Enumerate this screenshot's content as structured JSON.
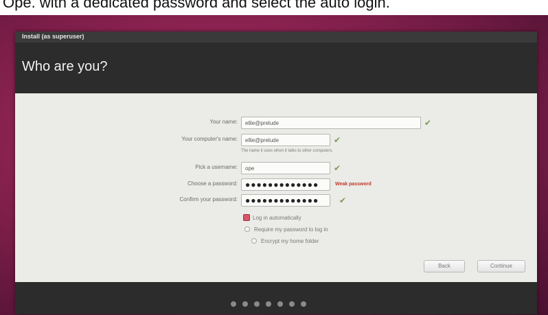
{
  "caption": {
    "text": "Ope. with a dedicated password and select the auto login."
  },
  "window": {
    "title": "Install (as superuser)",
    "heading": "Who are you?"
  },
  "form": {
    "name": {
      "label": "Your name:",
      "value": "ellie@prelude"
    },
    "computer_name": {
      "label": "Your computer's name:",
      "value": "ellie@prelude",
      "hint": "The name it uses when it talks to other computers."
    },
    "username": {
      "label": "Pick a username:",
      "value": "ope"
    },
    "password": {
      "label": "Choose a password:",
      "value": "●●●●●●●●●●●●●",
      "strength": "Weak password"
    },
    "confirm": {
      "label": "Confirm your password:",
      "value": "●●●●●●●●●●●●●"
    },
    "options": {
      "login_auto": "Log in automatically",
      "require_password": "Require my password to log in",
      "encrypt_home": "Encrypt my home folder"
    },
    "tick_glyph": "✔"
  },
  "buttons": {
    "back": "Back",
    "continue": "Continue"
  },
  "progress": {
    "total_steps": 7
  },
  "colors": {
    "accent": "#d6566a",
    "weak": "#c0392b",
    "background": "#8a2250"
  }
}
